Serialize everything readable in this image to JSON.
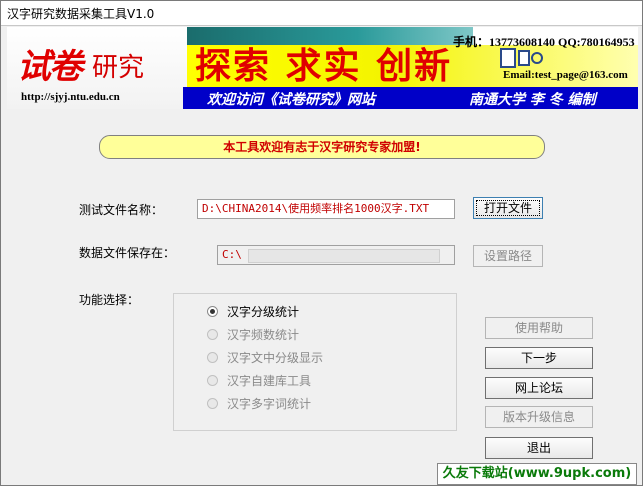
{
  "window": {
    "title": "汉字研究数据采集工具V1.0"
  },
  "banner": {
    "logo_main": "试卷",
    "logo_sub": "研究",
    "url": "http://sjyj.ntu.edu.cn",
    "slogan": "探索 求实 创新",
    "phone": "手机：13773608140  QQ:780164953",
    "email": "Email:test_page@163.com",
    "welcome": "欢迎访问《试卷研究》网站",
    "author": "南通大学 李 冬 编制"
  },
  "notice": "本工具欢迎有志于汉字研究专家加盟!",
  "test_file": {
    "label": "测试文件名称：",
    "value": "D:\\CHINA2014\\使用频率排名1000汉字.TXT",
    "button": "打开文件"
  },
  "data_file": {
    "label": "数据文件保存在：",
    "value": "C:\\",
    "button": "设置路径"
  },
  "functions": {
    "label": "功能选择：",
    "options": [
      {
        "label": "汉字分级统计",
        "selected": true
      },
      {
        "label": "汉字频数统计",
        "selected": false
      },
      {
        "label": "汉字文中分级显示",
        "selected": false
      },
      {
        "label": "汉字自建库工具",
        "selected": false
      },
      {
        "label": "汉字多字词统计",
        "selected": false
      }
    ]
  },
  "side_buttons": {
    "help": "使用帮助",
    "next": "下一步",
    "forum": "网上论坛",
    "upgrade": "版本升级信息",
    "exit": "退出"
  },
  "watermark": "久友下载站(www.9upk.com)"
}
